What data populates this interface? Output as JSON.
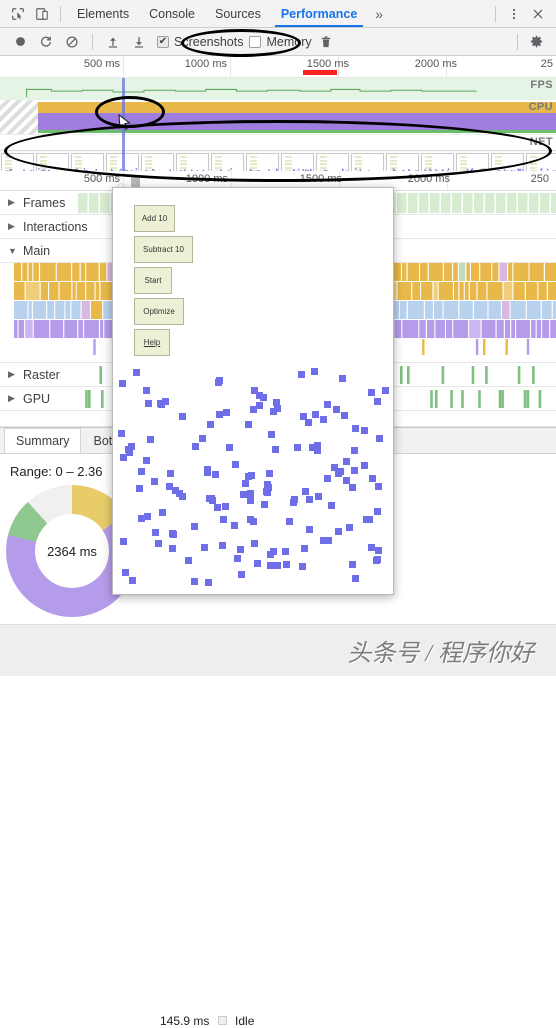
{
  "window": {
    "tabs": [
      {
        "label": "Elements",
        "active": false
      },
      {
        "label": "Console",
        "active": false
      },
      {
        "label": "Sources",
        "active": false
      },
      {
        "label": "Performance",
        "active": true
      }
    ],
    "overflow_label": "»",
    "inspect_icon": "inspect-cursor-icon",
    "device_icon": "device-toolbar-icon",
    "more_icon": "kebab-menu-icon",
    "close_icon": "close-icon"
  },
  "toolbar": {
    "record_icon": "record-circle-icon",
    "reload_icon": "reload-record-icon",
    "clear_icon": "clear-prohibited-icon",
    "upload_icon": "upload-profile-icon",
    "download_icon": "download-profile-icon",
    "trash_icon": "trash-icon",
    "settings_icon": "gear-icon",
    "screenshots": {
      "label": "Screenshots",
      "checked": true
    },
    "memory": {
      "label": "Memory",
      "checked": false
    }
  },
  "overview": {
    "ticks": [
      "500 ms",
      "1000 ms",
      "1500 ms",
      "2000 ms",
      "25"
    ],
    "bands": [
      {
        "label": "FPS"
      },
      {
        "label": "CPU"
      },
      {
        "label": "NET"
      }
    ],
    "red_marker": true,
    "filmstrip_frame_count": 17
  },
  "flame_ruler": {
    "ticks": [
      "500 ms",
      "1000 ms",
      "1500 ms",
      "2000 ms",
      "250"
    ]
  },
  "tracks": [
    {
      "name": "Frames",
      "expanded": false,
      "arrow": "▶"
    },
    {
      "name": "Interactions",
      "expanded": false,
      "arrow": "▶"
    },
    {
      "name": "Main",
      "expanded": true,
      "arrow": "▼"
    },
    {
      "name": "Raster",
      "expanded": false,
      "arrow": "▶"
    },
    {
      "name": "GPU",
      "expanded": false,
      "arrow": "▶"
    }
  ],
  "drawer": {
    "tabs": [
      {
        "label": "Summary",
        "active": true
      },
      {
        "label": "Bottom-Up",
        "active": false
      }
    ],
    "range_label": "Range: 0 – 2.36",
    "donut_center": "2364 ms",
    "legend": [
      {
        "label": "Idle",
        "value": "145.9 ms",
        "color": "#f0f0f0"
      }
    ]
  },
  "screenshot_popup": {
    "buttons": [
      {
        "label": "Add 10"
      },
      {
        "label": "Subtract 10"
      },
      {
        "label": "Start"
      },
      {
        "label": "Optimize"
      },
      {
        "label": "Help"
      }
    ],
    "dot_count": 150
  },
  "annotations": {
    "ellipse_count": 3
  },
  "watermark": {
    "text": "头条号 / 程序你好"
  },
  "colors": {
    "accent": "#1a73e8",
    "scripting": "#e8b94a",
    "rendering": "#b8d2ee",
    "painting": "#b59cea",
    "gpu": "#8fc98f",
    "idle": "#f0f0f0",
    "dot": "#6e6ee8",
    "popup_button": "#eef0d5",
    "marker_red": "#ff2222"
  }
}
